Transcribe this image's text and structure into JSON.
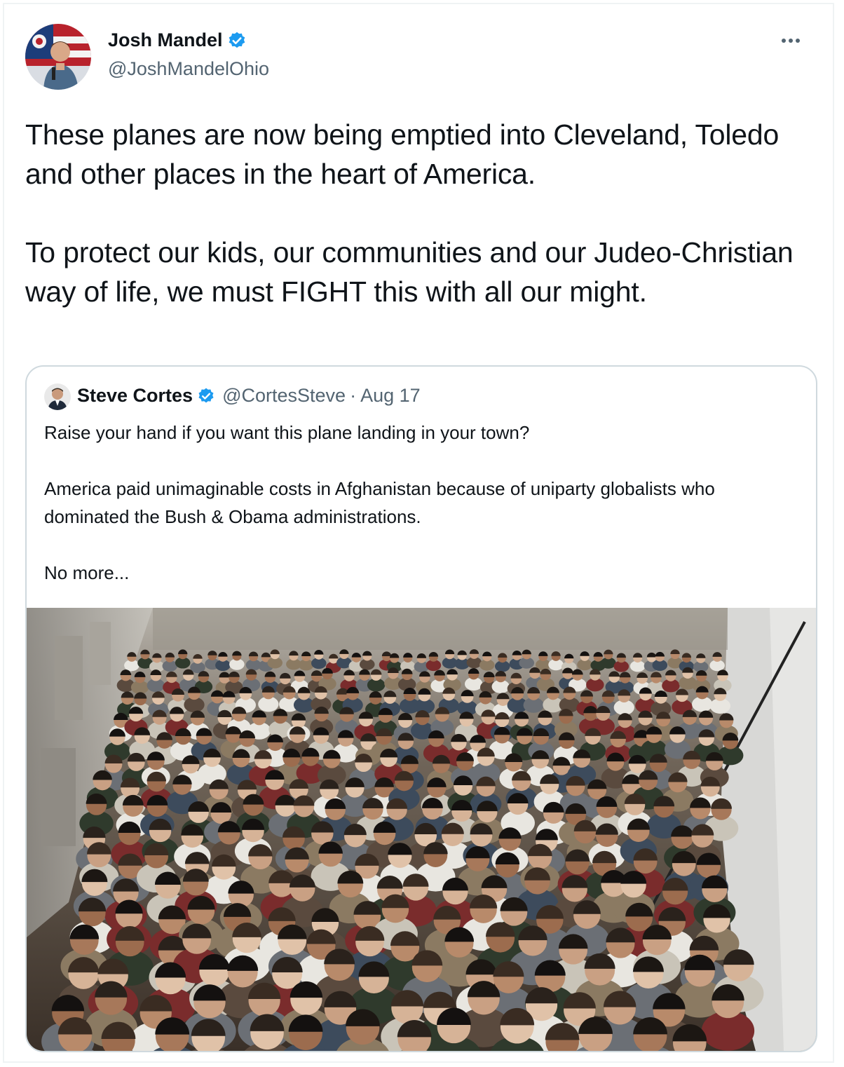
{
  "tweet": {
    "author": {
      "name": "Josh Mandel",
      "handle": "@JoshMandelOhio",
      "verified": true
    },
    "text": "These planes are now being emptied into Cleveland, Toledo and other places in the heart of America.\n\nTo protect our kids, our communities and our Judeo-Christian way of life, we must FIGHT this with all our might.",
    "more_icon": "more-horizontal-icon"
  },
  "quote": {
    "author": {
      "name": "Steve Cortes",
      "handle": "@CortesSteve",
      "separator": "·",
      "date": "Aug 17",
      "verified": true
    },
    "text": "Raise your hand if you want this plane landing in your town?\n\nAmerica paid unimaginable costs in Afghanistan because of uniparty globalists who dominated the Bush & Obama administrations.\n\nNo more..."
  },
  "colors": {
    "verified_blue": "#1d9bf0",
    "secondary_text": "#536471",
    "primary_text": "#0f1419",
    "border": "#cfd9de"
  }
}
